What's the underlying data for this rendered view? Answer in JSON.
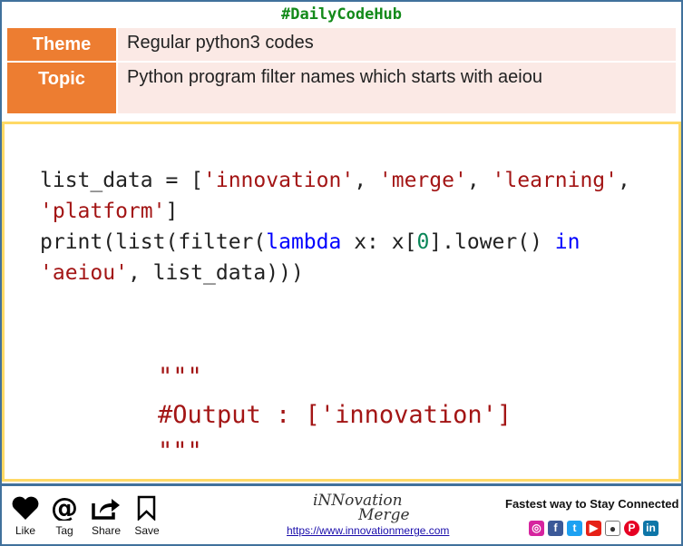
{
  "header": {
    "hashtag": "#DailyCodeHub"
  },
  "info": [
    {
      "label": "Theme",
      "value": "Regular python3 codes"
    },
    {
      "label": "Topic",
      "value": "Python program filter names which starts with aeiou"
    }
  ],
  "code": {
    "l1_a": "list_data = [",
    "s1": "'innovation'",
    "sep": ", ",
    "s2": "'merge'",
    "s3": "'learning'",
    "comma": ",",
    "s4": "'platform'",
    "close": "]",
    "l3_a": "print(list(filter(",
    "kw_lambda": "lambda",
    "l3_b": " x: x[",
    "num0": "0",
    "l3_c": "].lower() ",
    "kw_in": "in",
    "s5": "'aeiou'",
    "l4_b": ", list_data)))"
  },
  "output": {
    "quote_open": "\"\"\"",
    "text": "#Output : ['innovation']",
    "quote_close": "\"\"\""
  },
  "footer": {
    "actions": [
      {
        "label": "Like",
        "icon": "heart-icon"
      },
      {
        "label": "Tag",
        "icon": "at-icon"
      },
      {
        "label": "Share",
        "icon": "share-icon"
      },
      {
        "label": "Save",
        "icon": "bookmark-icon"
      }
    ],
    "logo_top": "iNNovation",
    "logo_bottom": "Merge",
    "url": "https://www.innovationmerge.com",
    "connect": "Fastest way to Stay Connected",
    "social": [
      {
        "name": "instagram",
        "glyph": "◎",
        "color": "#d6249f"
      },
      {
        "name": "facebook",
        "glyph": "f",
        "color": "#3b5998"
      },
      {
        "name": "twitter",
        "glyph": "t",
        "color": "#1da1f2"
      },
      {
        "name": "youtube",
        "glyph": "▶",
        "color": "#e62117"
      },
      {
        "name": "github",
        "glyph": "●",
        "color": "#555555"
      },
      {
        "name": "pinterest",
        "glyph": "P",
        "color": "#e60023"
      },
      {
        "name": "linkedin",
        "glyph": "in",
        "color": "#0e76a8"
      }
    ]
  }
}
